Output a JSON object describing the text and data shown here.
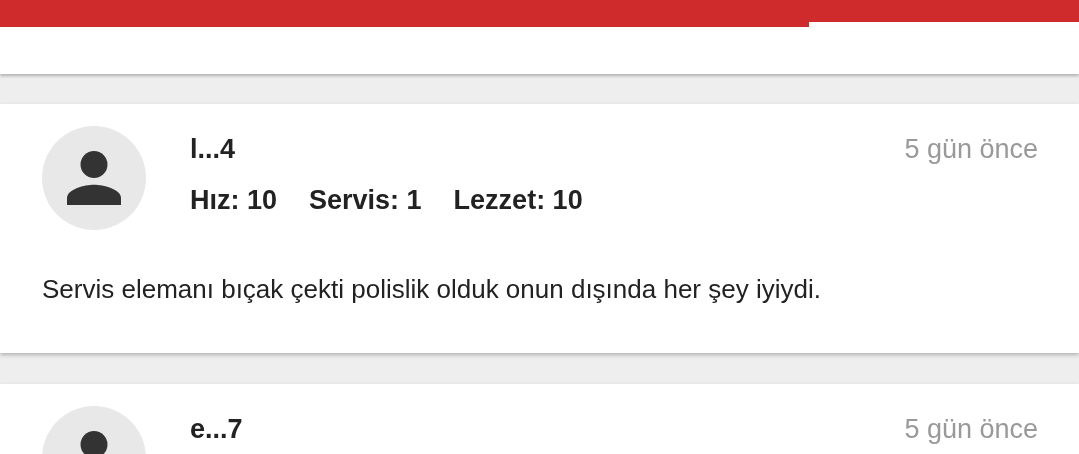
{
  "progress": {
    "level": 0.75
  },
  "reviews": [
    {
      "user": "l...4",
      "date": "5 gün önce",
      "ratings": [
        "Hız: 10",
        "Servis: 1",
        "Lezzet: 10"
      ],
      "comment": "Servis elemanı bıçak çekti polislik olduk onun dışında her şey iyiydi."
    },
    {
      "user": "e...7",
      "date": "5 gün önce"
    }
  ]
}
